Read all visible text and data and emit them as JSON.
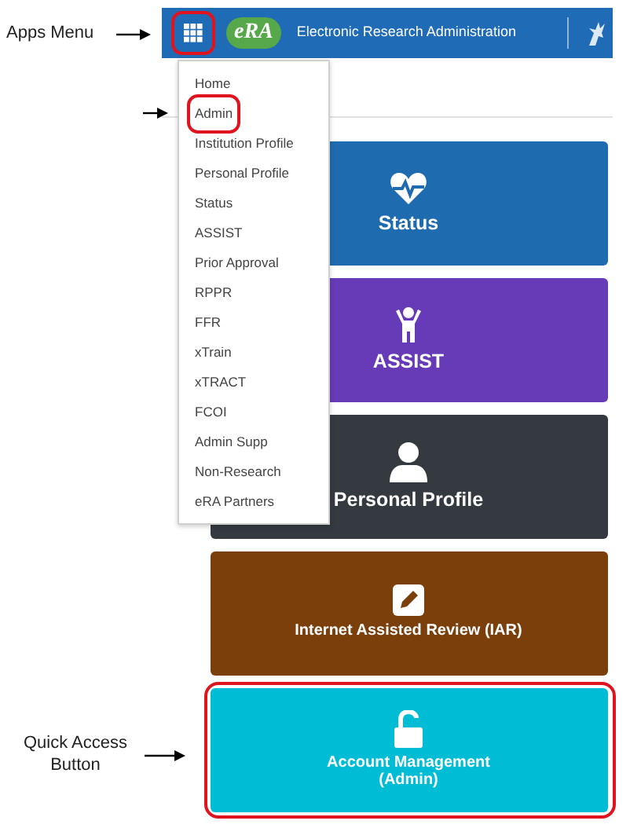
{
  "callouts": [
    {
      "kind": "apps",
      "text": "Apps Menu"
    },
    {
      "kind": "admin"
    },
    {
      "kind": "quick",
      "text": "Quick Access Button"
    }
  ],
  "header": {
    "apps_button": {
      "highlighted": true
    },
    "logo": "eRA",
    "title": "Electronic Research Administration"
  },
  "apps_menu": {
    "items": [
      {
        "label": "Home",
        "highlighted": false
      },
      {
        "label": "Admin",
        "highlighted": true
      },
      {
        "label": "Institution Profile",
        "highlighted": false
      },
      {
        "label": "Personal Profile",
        "highlighted": false
      },
      {
        "label": "Status",
        "highlighted": false
      },
      {
        "label": "ASSIST",
        "highlighted": false
      },
      {
        "label": "Prior Approval",
        "highlighted": false
      },
      {
        "label": "RPPR",
        "highlighted": false
      },
      {
        "label": "FFR",
        "highlighted": false
      },
      {
        "label": "xTrain",
        "highlighted": false
      },
      {
        "label": "xTRACT",
        "highlighted": false
      },
      {
        "label": "FCOI",
        "highlighted": false
      },
      {
        "label": "Admin Supp",
        "highlighted": false
      },
      {
        "label": "Non-Research",
        "highlighted": false
      },
      {
        "label": "eRA Partners",
        "highlighted": false
      }
    ]
  },
  "tiles": [
    {
      "kind": "status",
      "label": "Status",
      "color": "#1f6bb0",
      "highlighted": false
    },
    {
      "kind": "assist",
      "label": "ASSIST",
      "color": "#673ab7",
      "highlighted": false
    },
    {
      "kind": "profile",
      "label": "Personal Profile",
      "color": "#343a40",
      "highlighted": false
    },
    {
      "kind": "iar",
      "label": "Internet Assisted Review (IAR)",
      "color": "#7b3f0c",
      "highlighted": false
    },
    {
      "kind": "account",
      "label": "Account Management\n(Admin)",
      "color": "#00bcd4",
      "highlighted": true
    }
  ]
}
